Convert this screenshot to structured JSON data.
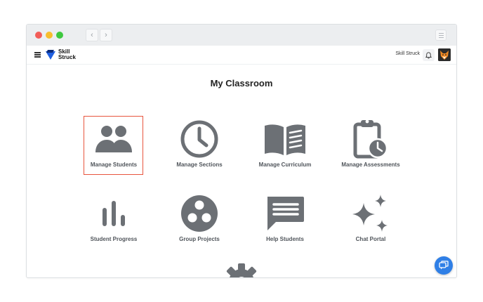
{
  "header": {
    "logo_text": "Skill Struck",
    "user_name": "Skill Struck"
  },
  "main": {
    "title": "My Classroom",
    "tiles": [
      {
        "label": "Manage Students",
        "icon": "people-icon",
        "selected": true
      },
      {
        "label": "Manage Sections",
        "icon": "clock-icon",
        "selected": false
      },
      {
        "label": "Manage Curriculum",
        "icon": "book-icon",
        "selected": false
      },
      {
        "label": "Manage Assessments",
        "icon": "clipboard-clock-icon",
        "selected": false
      },
      {
        "label": "Student Progress",
        "icon": "bar-chart-icon",
        "selected": false
      },
      {
        "label": "Group Projects",
        "icon": "group-circle-icon",
        "selected": false
      },
      {
        "label": "Help Students",
        "icon": "chat-bubble-icon",
        "selected": false
      },
      {
        "label": "Chat Portal",
        "icon": "sparkles-icon",
        "selected": false
      }
    ]
  },
  "colors": {
    "icon_gray": "#6c7075",
    "selection_border": "#e8553e",
    "fab_blue": "#2f7fe6",
    "logo_blue": "#1f5fe0"
  }
}
